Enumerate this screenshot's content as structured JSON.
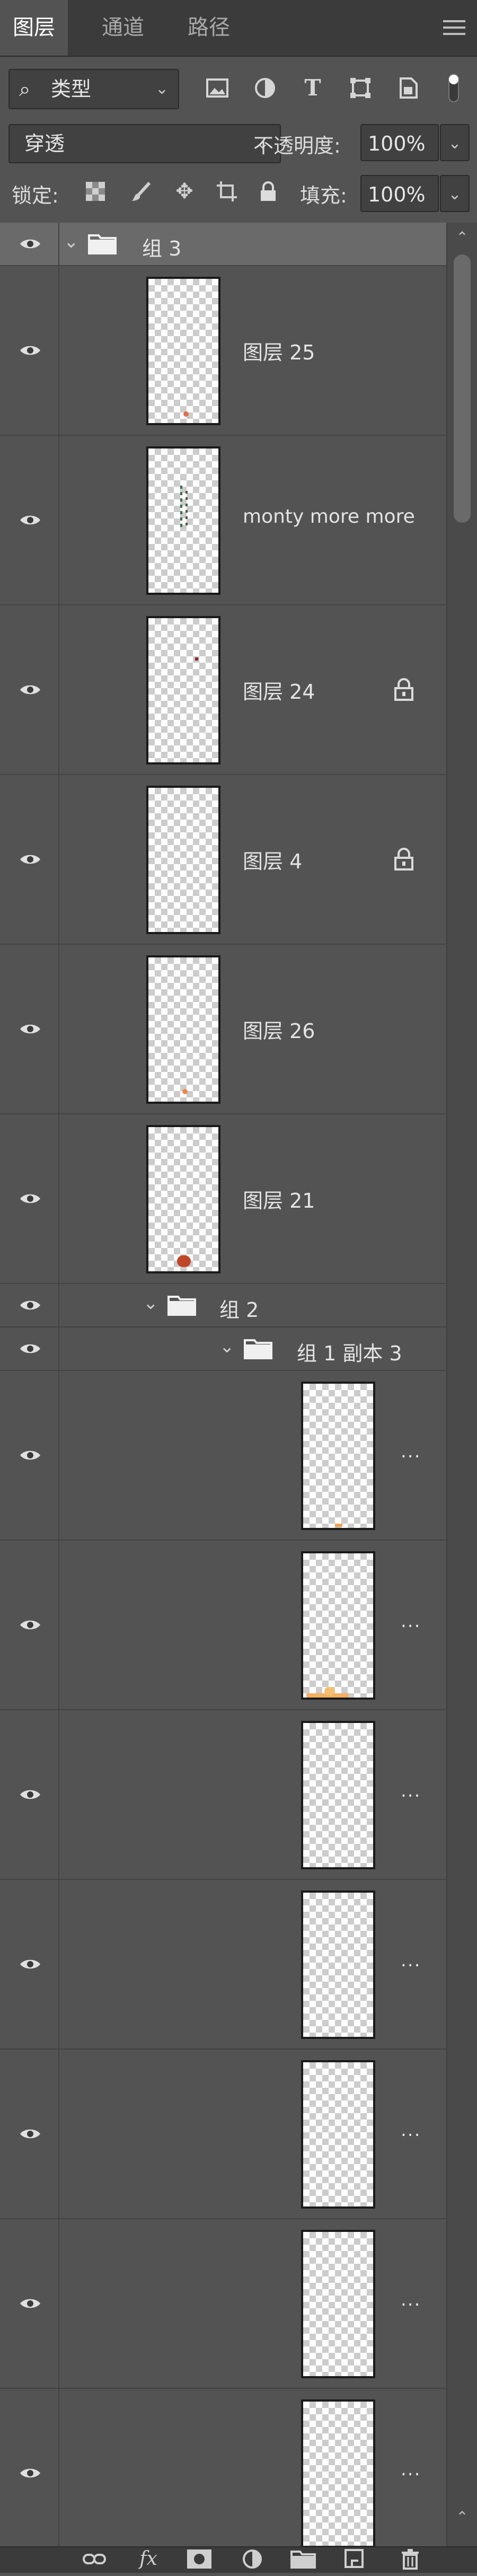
{
  "tabs": [
    {
      "label": "图层",
      "active": true
    },
    {
      "label": "通道",
      "active": false
    },
    {
      "label": "路径",
      "active": false
    }
  ],
  "filter": {
    "kind_label": "类型",
    "icons": [
      "image-filter-icon",
      "adjustment-filter-icon",
      "type-filter-icon",
      "shape-filter-icon",
      "smart-object-filter-icon",
      "filter-toggle-icon"
    ]
  },
  "blend": {
    "mode": "穿透",
    "opacity_label": "不透明度:",
    "opacity_value": "100%"
  },
  "lock": {
    "label": "锁定:",
    "fill_label": "填充:",
    "fill_value": "100%"
  },
  "layers": [
    {
      "kind": "group",
      "name": "组 3",
      "indent": 0,
      "selected": true
    },
    {
      "kind": "layer",
      "name": "图层 25",
      "locked": false
    },
    {
      "kind": "layer",
      "name": "monty more more",
      "locked": false
    },
    {
      "kind": "layer",
      "name": "图层 24",
      "locked": true
    },
    {
      "kind": "layer",
      "name": "图层 4",
      "locked": true
    },
    {
      "kind": "layer",
      "name": "图层 26",
      "locked": false
    },
    {
      "kind": "layer",
      "name": "图层 21",
      "locked": false
    },
    {
      "kind": "group",
      "name": "组 2",
      "indent": 1
    },
    {
      "kind": "group",
      "name": "组 1 副本 3",
      "indent": 2
    },
    {
      "kind": "layer",
      "name": "...",
      "locked": false
    },
    {
      "kind": "layer",
      "name": "...",
      "locked": false
    },
    {
      "kind": "layer",
      "name": "...",
      "locked": false
    },
    {
      "kind": "layer",
      "name": "...",
      "locked": false
    },
    {
      "kind": "layer",
      "name": "...",
      "locked": false
    },
    {
      "kind": "layer",
      "name": "...",
      "locked": false
    },
    {
      "kind": "layer",
      "name": "...",
      "locked": false
    }
  ],
  "bottom": {
    "fx_label": "fx",
    "icons": [
      "link-layers-icon",
      "fx-icon",
      "mask-icon",
      "adjustment-layer-icon",
      "new-group-icon",
      "new-layer-icon",
      "delete-icon"
    ]
  }
}
